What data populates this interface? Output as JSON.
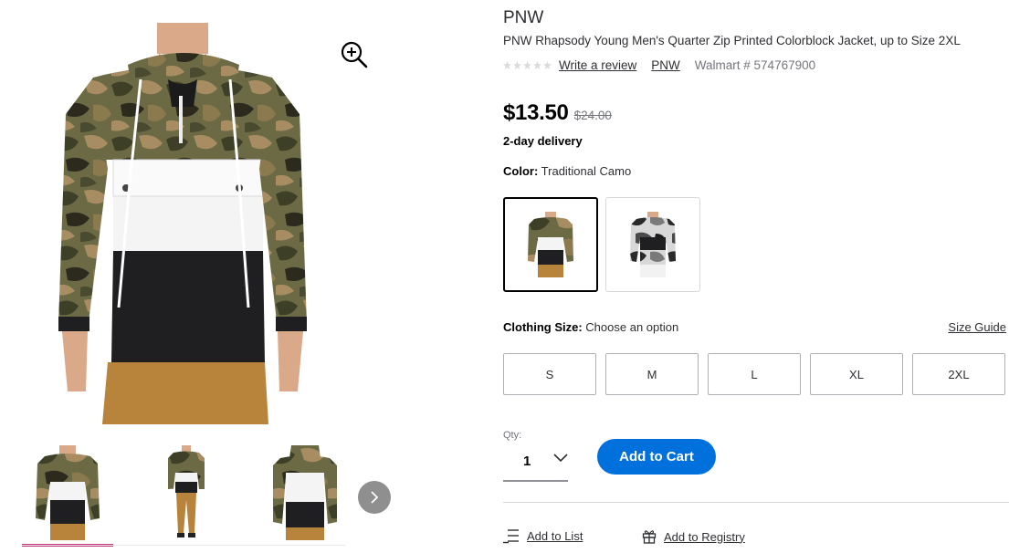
{
  "product": {
    "brand": "PNW",
    "title": "PNW Rhapsody Young Men's Quarter Zip Printed Colorblock Jacket, up to Size 2XL",
    "write_review": "Write a review",
    "brand_link": "PNW",
    "walmart_id": "Walmart # 574767900",
    "rating_stars": 0
  },
  "pricing": {
    "price": "$13.50",
    "was_price": "$24.00",
    "delivery": "2-day delivery"
  },
  "color": {
    "label": "Color:",
    "selected": "Traditional Camo",
    "swatches": [
      "traditional-camo",
      "grey-camo"
    ]
  },
  "size": {
    "label": "Clothing Size:",
    "prompt": "Choose an option",
    "guide": "Size Guide",
    "options": [
      "S",
      "M",
      "L",
      "XL",
      "2XL"
    ]
  },
  "quantity": {
    "label": "Qty:",
    "value": "1"
  },
  "actions": {
    "add_to_cart": "Add to Cart",
    "add_to_list": "Add to List",
    "add_to_registry": "Add to Registry"
  },
  "gallery": {
    "thumbnail_count": 3,
    "active_thumbnail": 0
  },
  "colors": {
    "accent_blue": "#0071dc",
    "active_thumb_bar": "#c7387e",
    "muted_text": "#74767c"
  },
  "icons": [
    "zoom-in-icon",
    "chevron-right-icon",
    "chevron-down-icon",
    "list-icon",
    "gift-icon",
    "star-icon"
  ]
}
